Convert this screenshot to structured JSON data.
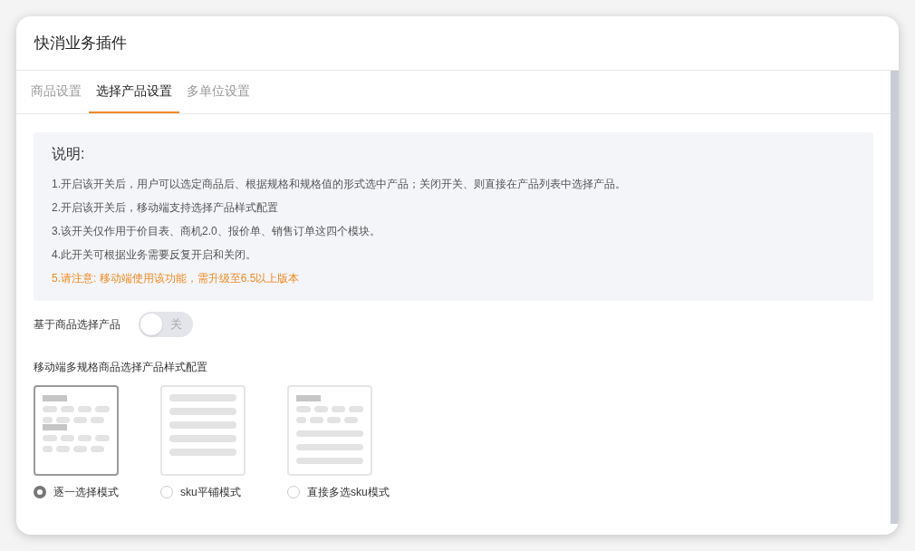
{
  "dialog": {
    "title": "快消业务插件"
  },
  "tabs": [
    {
      "label": "商品设置",
      "selected": false
    },
    {
      "label": "选择产品设置",
      "selected": true
    },
    {
      "label": "多单位设置",
      "selected": false
    }
  ],
  "notice": {
    "heading": "说明:",
    "items": [
      {
        "kind": "note",
        "text": "1.开启该开关后，用户可以选定商品后、根据规格和规格值的形式选中产品；关闭开关、则直接在产品列表中选择产品。"
      },
      {
        "kind": "note",
        "text": "2.开启该开关后，移动端支持选择产品样式配置"
      },
      {
        "kind": "note",
        "text": "3.该开关仅作用于价目表、商机2.0、报价单、销售订单这四个模块。"
      },
      {
        "kind": "note",
        "text": "4.此开关可根据业务需要反复开启和关闭。"
      },
      {
        "kind": "warning",
        "text": "5.请注意: 移动端使用该功能，需升级至6.5以上版本"
      }
    ]
  },
  "toggle": {
    "label": "基于商品选择产品",
    "on": false,
    "state_text": "关"
  },
  "style_config": {
    "label": "移动端多规格商品选择产品样式配置",
    "options": [
      {
        "kind": "stepwise",
        "label": "逐一选择模式",
        "selected": true
      },
      {
        "kind": "tiled",
        "label": "sku平铺模式",
        "selected": false
      },
      {
        "kind": "mixed",
        "label": "直接多选sku模式",
        "selected": false
      }
    ]
  }
}
